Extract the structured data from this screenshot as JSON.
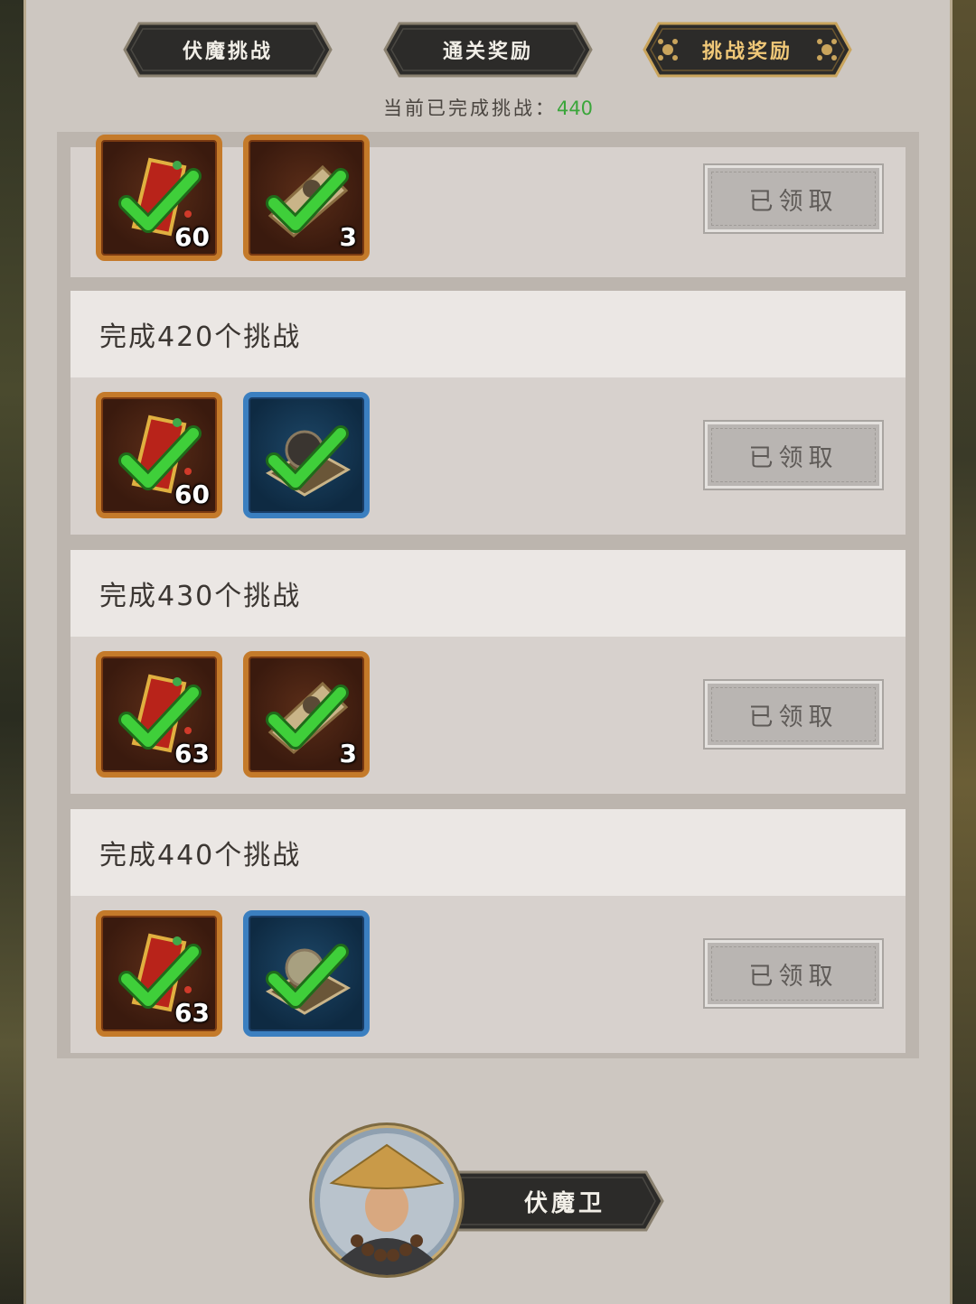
{
  "tabs": [
    {
      "label": "伏魔挑战",
      "active": false
    },
    {
      "label": "通关奖励",
      "active": false
    },
    {
      "label": "挑战奖励",
      "active": true
    }
  ],
  "progress": {
    "label": "当前已完成挑战：",
    "value": "440"
  },
  "rewards": [
    {
      "title": "",
      "items": [
        {
          "type": "orange",
          "icon": "red-scroll-icon",
          "qty": "60"
        },
        {
          "type": "orange",
          "icon": "parchment-icon",
          "qty": "3"
        }
      ],
      "status": "已领取"
    },
    {
      "title": "完成420个挑战",
      "items": [
        {
          "type": "orange",
          "icon": "red-scroll-icon",
          "qty": "60"
        },
        {
          "type": "blue",
          "icon": "orb-chest-icon",
          "qty": ""
        }
      ],
      "status": "已领取"
    },
    {
      "title": "完成430个挑战",
      "items": [
        {
          "type": "orange",
          "icon": "red-scroll-icon",
          "qty": "63"
        },
        {
          "type": "orange",
          "icon": "parchment-icon",
          "qty": "3"
        }
      ],
      "status": "已领取"
    },
    {
      "title": "完成440个挑战",
      "items": [
        {
          "type": "orange",
          "icon": "red-scroll-icon",
          "qty": "63"
        },
        {
          "type": "blue",
          "icon": "orb-chest-icon",
          "qty": ""
        }
      ],
      "status": "已领取"
    }
  ],
  "character": {
    "name": "伏魔卫"
  },
  "colors": {
    "panel": "#cdc7c1",
    "header_row": "#ebe7e4",
    "body_row": "#d7d1cd",
    "progress_number": "#3aa63a",
    "active_tab_text": "#f0c878",
    "check": "#3fcf3a"
  }
}
